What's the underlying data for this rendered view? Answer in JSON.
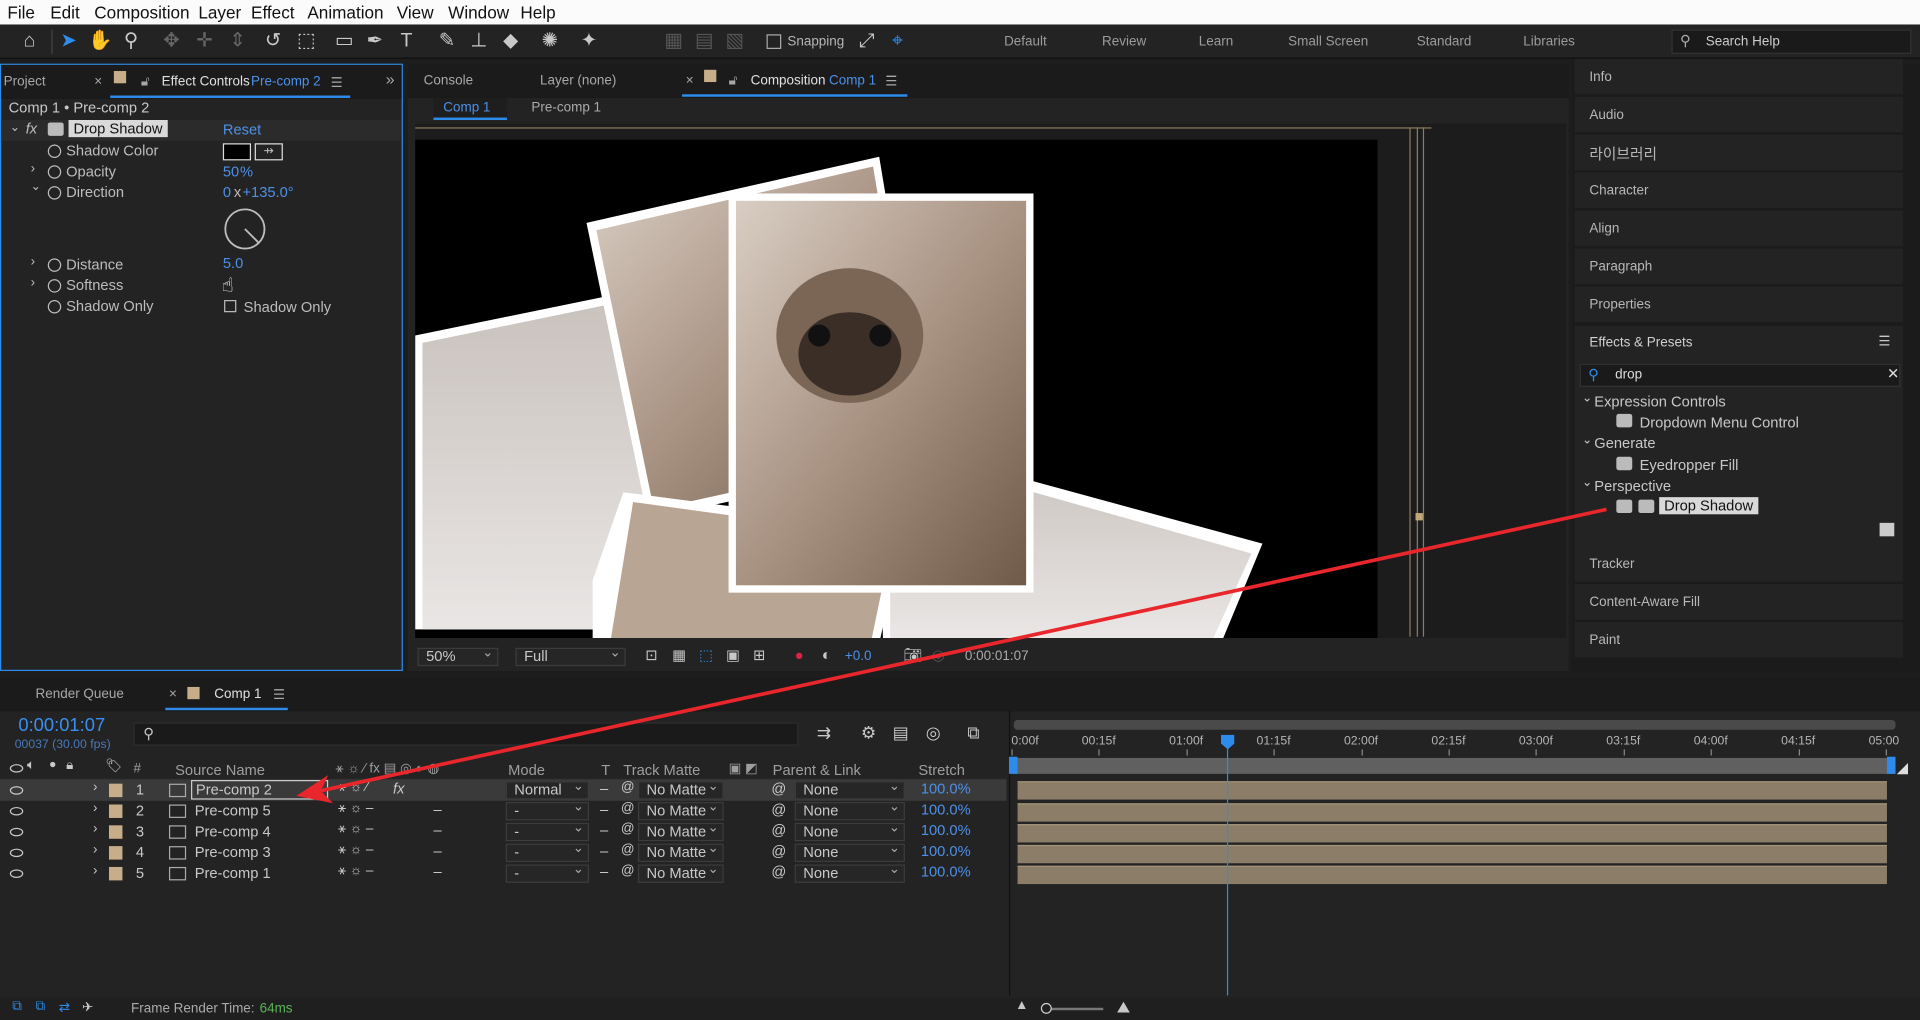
{
  "menubar": {
    "items": [
      "File",
      "Edit",
      "Composition",
      "Layer",
      "Effect",
      "Animation",
      "View",
      "Window",
      "Help"
    ]
  },
  "toolbar": {
    "snapping_label": "Snapping",
    "workspaces": [
      "Default",
      "Review",
      "Learn",
      "Small Screen",
      "Standard",
      "Libraries"
    ],
    "search_placeholder": "Search Help"
  },
  "left_panel": {
    "project_tab": "Project",
    "effect_controls_tab": "Effect Controls",
    "effect_controls_target": "Pre-comp 2",
    "breadcrumb": "Comp 1 • Pre-comp 2",
    "effect_name": "Drop Shadow",
    "reset_label": "Reset",
    "properties": {
      "shadow_color": "Shadow Color",
      "opacity": "Opacity",
      "opacity_value": "50",
      "opacity_unit": "%",
      "direction": "Direction",
      "direction_rev": "0",
      "direction_x": "x",
      "direction_deg": "+135.0°",
      "distance": "Distance",
      "distance_value": "5.0",
      "softness": "Softness",
      "shadow_only": "Shadow Only",
      "shadow_only_checkbox_label": "Shadow Only"
    }
  },
  "viewer": {
    "tabs": {
      "console": "Console",
      "layer": "Layer (none)",
      "composition": "Composition",
      "composition_target": "Comp 1"
    },
    "breadcrumbs": [
      "Comp 1",
      "Pre-comp 1"
    ],
    "zoom": "50%",
    "resolution": "Full",
    "exposure": "+0.0",
    "timecode": "0:00:01:07"
  },
  "right_panel": {
    "items_top": [
      "Info",
      "Audio",
      "라이브러리",
      "Character",
      "Align",
      "Paragraph",
      "Properties"
    ],
    "effects_presets_title": "Effects & Presets",
    "search_value": "drop",
    "tree": [
      {
        "category": "Expression Controls",
        "effects": [
          "Dropdown Menu Control"
        ]
      },
      {
        "category": "Generate",
        "effects": [
          "Eyedropper Fill"
        ]
      },
      {
        "category": "Perspective",
        "effects": [
          "Drop Shadow"
        ]
      }
    ],
    "items_bottom": [
      "Tracker",
      "Content-Aware Fill",
      "Paint"
    ]
  },
  "timeline": {
    "render_queue_tab": "Render Queue",
    "comp_tab": "Comp 1",
    "current_time": "0:00:01:07",
    "frame_info": "00037 (30.00 fps)",
    "columns": {
      "num": "#",
      "source": "Source Name",
      "mode": "Mode",
      "t": "T",
      "track_matte": "Track Matte",
      "parent": "Parent & Link",
      "stretch": "Stretch"
    },
    "ruler": [
      "0:00f",
      "00:15f",
      "01:00f",
      "01:15f",
      "02:00f",
      "02:15f",
      "03:00f",
      "03:15f",
      "04:00f",
      "04:15f",
      "05:00"
    ],
    "playhead_fraction": 0.2467,
    "layers": [
      {
        "num": "1",
        "name": "Pre-comp 2",
        "mode": "Normal",
        "matte": "No Matte",
        "parent": "None",
        "stretch": "100.0%",
        "fx": "fx"
      },
      {
        "num": "2",
        "name": "Pre-comp 5",
        "mode": "-",
        "matte": "No Matte",
        "parent": "None",
        "stretch": "100.0%"
      },
      {
        "num": "3",
        "name": "Pre-comp 4",
        "mode": "-",
        "matte": "No Matte",
        "parent": "None",
        "stretch": "100.0%"
      },
      {
        "num": "4",
        "name": "Pre-comp 3",
        "mode": "-",
        "matte": "No Matte",
        "parent": "None",
        "stretch": "100.0%"
      },
      {
        "num": "5",
        "name": "Pre-comp 1",
        "mode": "-",
        "matte": "No Matte",
        "parent": "None",
        "stretch": "100.0%"
      }
    ],
    "status_label": "Frame Render Time:",
    "status_value": "64ms"
  },
  "colors": {
    "accent": "#2d8ceb",
    "annotation_arrow": "#e8262b",
    "layer_label": "#c8ad8a"
  }
}
